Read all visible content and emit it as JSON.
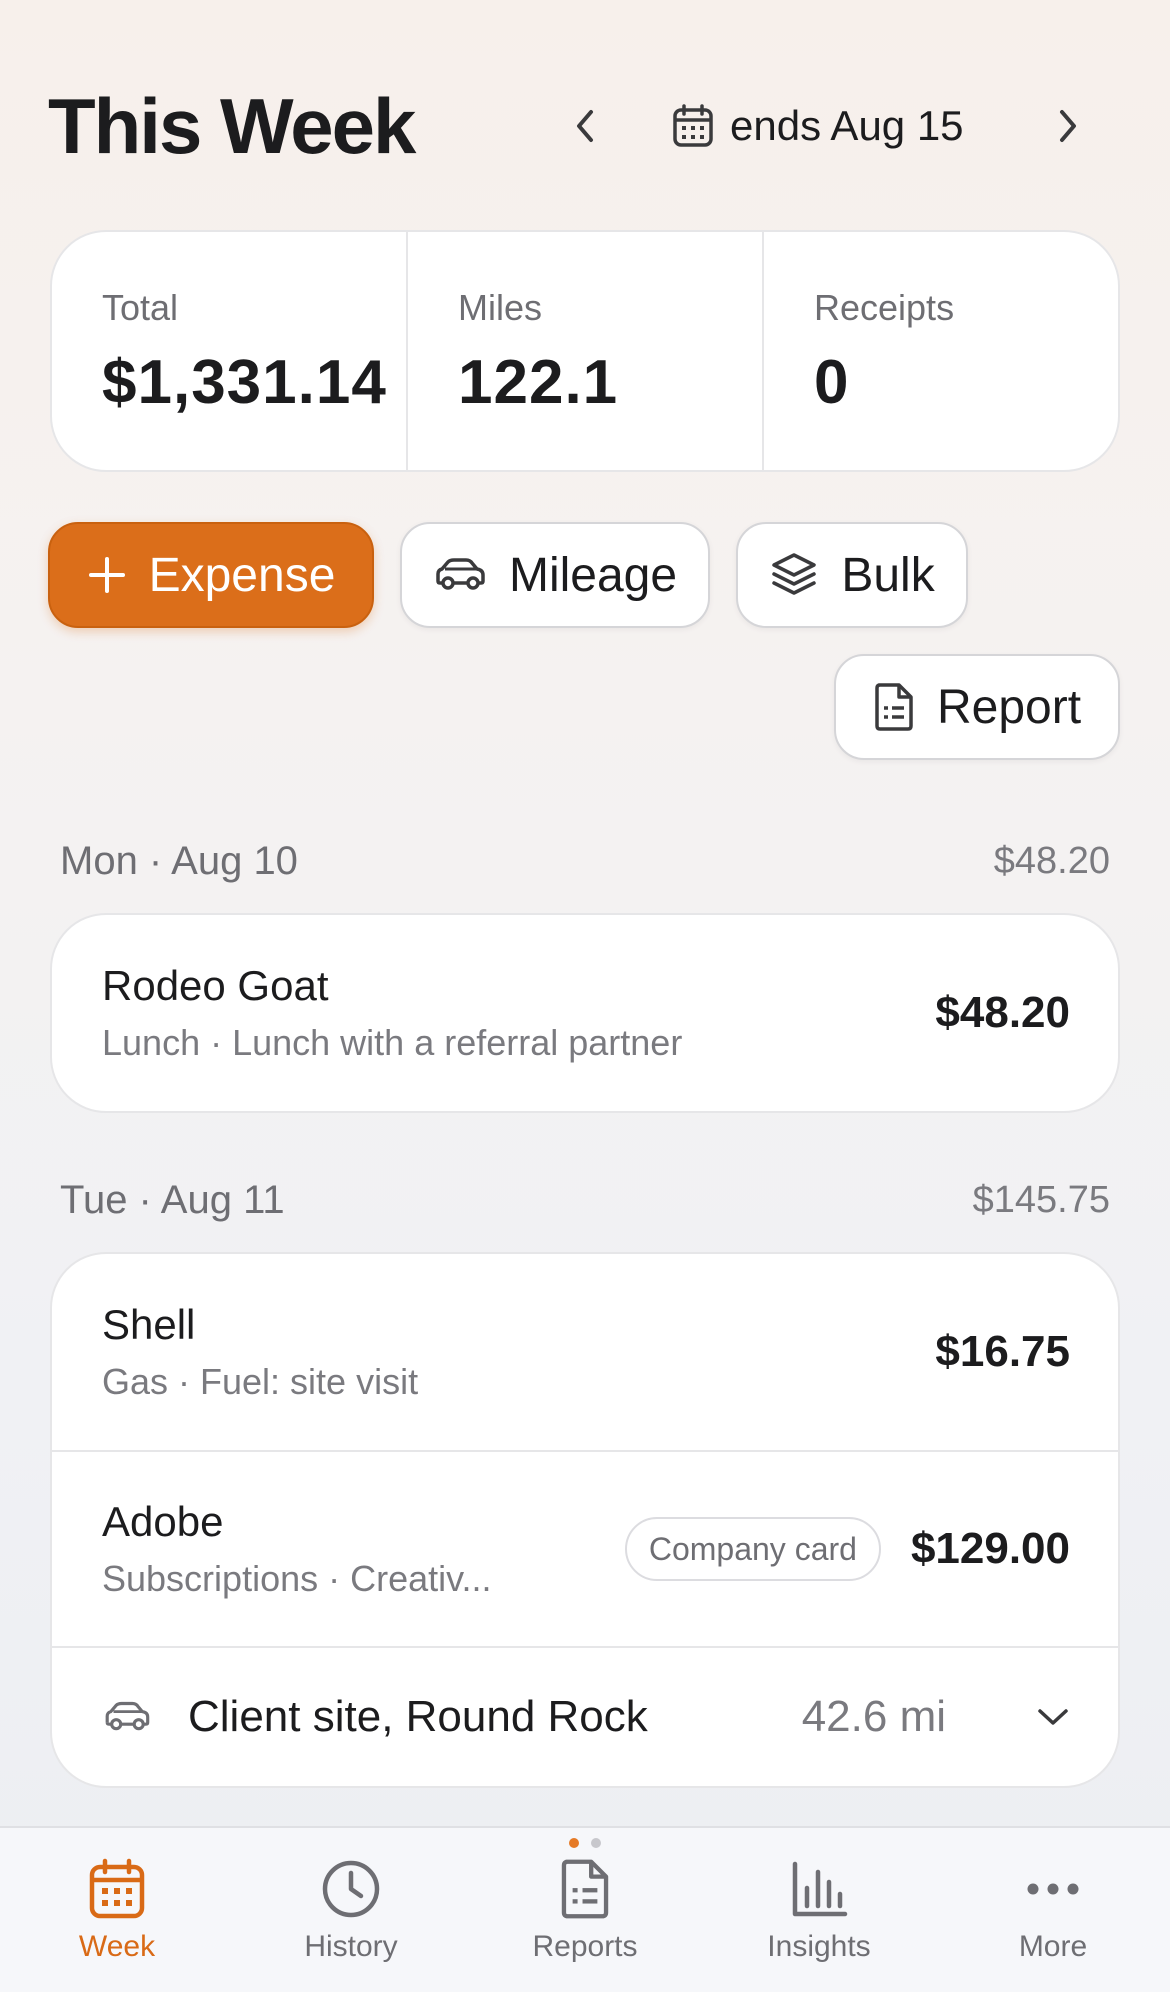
{
  "header": {
    "title": "This Week",
    "date_range": "ends Aug 15"
  },
  "stats": [
    {
      "label": "Total",
      "value": "$1,331.14"
    },
    {
      "label": "Miles",
      "value": "122.1"
    },
    {
      "label": "Receipts",
      "value": "0"
    }
  ],
  "actions": {
    "expense": "Expense",
    "mileage": "Mileage",
    "bulk": "Bulk",
    "report": "Report"
  },
  "days": [
    {
      "label": "Mon · Aug 10",
      "total": "$48.20",
      "entries": [
        {
          "title": "Rodeo Goat",
          "subtitle": "Lunch · Lunch with a referral partner",
          "amount": "$48.20"
        }
      ]
    },
    {
      "label": "Tue · Aug 11",
      "total": "$145.75",
      "entries": [
        {
          "title": "Shell",
          "subtitle": "Gas · Fuel: site visit",
          "amount": "$16.75"
        },
        {
          "title": "Adobe",
          "subtitle": "Subscriptions · Creativ...",
          "badge": "Company card",
          "amount": "$129.00"
        }
      ],
      "trip": {
        "label": "Client site, Round Rock",
        "miles": "42.6 mi"
      }
    }
  ],
  "tabs": [
    {
      "label": "Week",
      "icon": "calendar-icon",
      "active": true
    },
    {
      "label": "History",
      "icon": "clock-icon"
    },
    {
      "label": "Reports",
      "icon": "document-icon"
    },
    {
      "label": "Insights",
      "icon": "bar-chart-icon"
    },
    {
      "label": "More",
      "icon": "more-dots-icon"
    }
  ],
  "colors": {
    "accent": "#db6e1a",
    "tab_active": "#d96a16",
    "text_primary": "#1c1c1e",
    "text_secondary": "#7a7a7f"
  }
}
